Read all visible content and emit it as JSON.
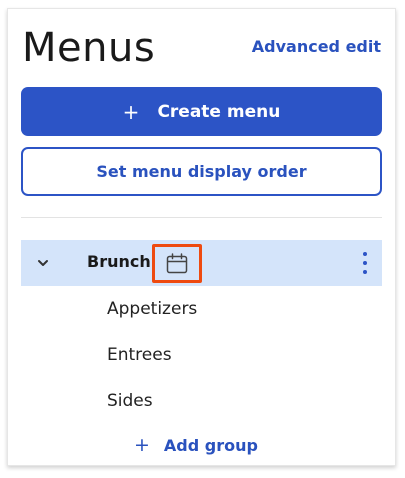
{
  "header": {
    "title": "Menus",
    "advanced_edit_label": "Advanced edit"
  },
  "actions": {
    "create_menu_plus": "+",
    "create_menu_label": "Create menu",
    "set_display_order_label": "Set menu display order"
  },
  "menu": {
    "name": "Brunch",
    "expanded": true,
    "icons": {
      "expand": "chevron-down-icon",
      "schedule": "calendar-icon",
      "more": "kebab-menu-icon"
    },
    "groups": [
      {
        "label": "Appetizers"
      },
      {
        "label": "Entrees"
      },
      {
        "label": "Sides"
      }
    ],
    "add_group_plus": "+",
    "add_group_label": "Add group"
  },
  "colors": {
    "primary": "#2c54c6",
    "link": "#2a52be",
    "selected_row": "#d4e4fa",
    "highlight": "#ee4a0f"
  }
}
